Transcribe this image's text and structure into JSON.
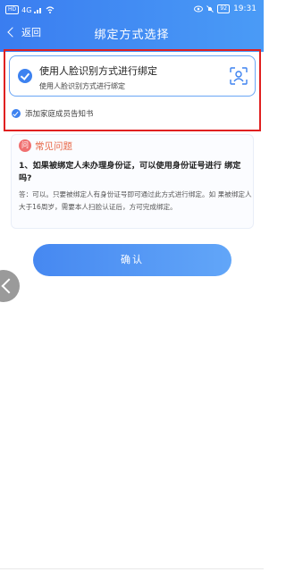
{
  "status_bar": {
    "left_chip": "HD",
    "signal_label": "4G",
    "battery": "92",
    "time": "19:31"
  },
  "nav": {
    "back_label": "返回",
    "title": "绑定方式选择"
  },
  "option": {
    "title": "使用人脸识别方式进行绑定",
    "subtitle": "使用人脸识别方式进行绑定",
    "selected": true
  },
  "notice": {
    "label": "添加家庭成员告知书",
    "checked": true
  },
  "faq": {
    "title": "常见问题",
    "icon_char": "问",
    "question": "1、如果被绑定人未办理身份证，可以使用身份证号进行 绑定吗?",
    "answer": "答：可以。只要被绑定人有身份证号即可通过此方式进行绑定。如 果被绑定人大于16周岁，需要本人扫脸认证后，方可完成绑定。"
  },
  "confirm_label": "确认",
  "colors": {
    "header": "#3a7df0",
    "accent": "#3d82f0",
    "highlight_border": "#e02020",
    "faq_title": "#e86a4a"
  }
}
